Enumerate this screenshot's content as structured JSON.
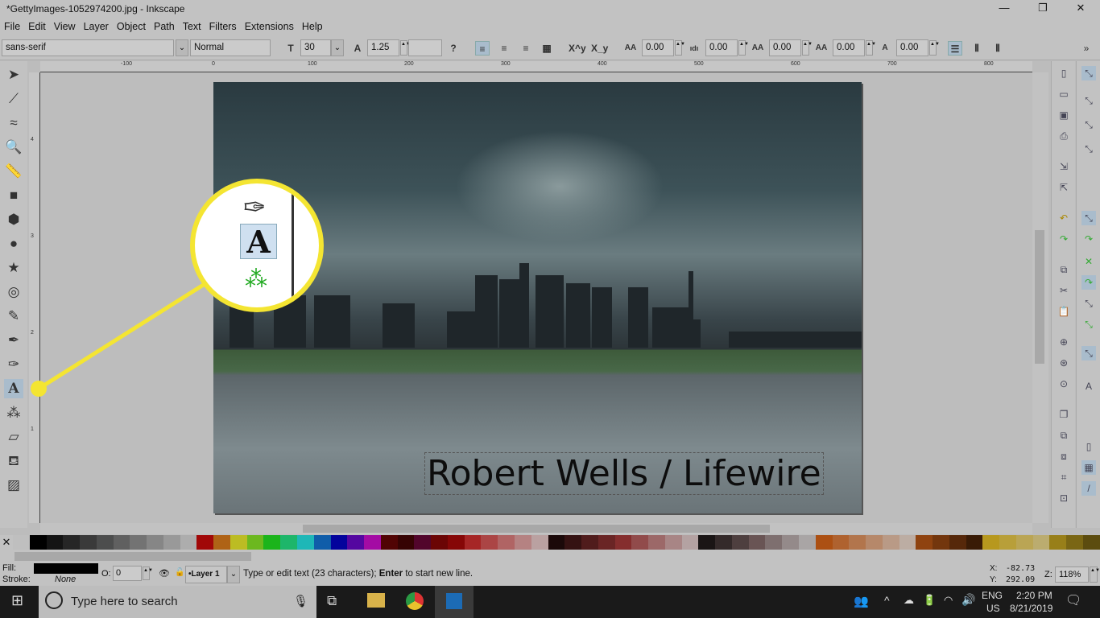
{
  "window": {
    "title": "*GettyImages-1052974200.jpg - Inkscape",
    "minimize": "—",
    "maximize": "❐",
    "close": "✕"
  },
  "menu": [
    "File",
    "Edit",
    "View",
    "Layer",
    "Object",
    "Path",
    "Text",
    "Filters",
    "Extensions",
    "Help"
  ],
  "text_toolbar": {
    "font_family": "sans-serif",
    "font_style": "Normal",
    "font_size": "30",
    "line_spacing": "1.25",
    "letter_spacing": "0.00",
    "word_spacing": "0.00",
    "kerning": "0.00",
    "vertical_shift": "0.00",
    "rotation": "0.00",
    "help": "?",
    "overflow": "»",
    "superscript": "X^y",
    "subscript": "X_y"
  },
  "ruler": {
    "h_ticks": [
      "-100",
      "0",
      "100",
      "200",
      "300",
      "400",
      "500",
      "600",
      "700",
      "800"
    ],
    "v_ticks": [
      "4",
      "3",
      "2",
      "1"
    ]
  },
  "tools": [
    "selector",
    "node",
    "tweak",
    "zoom",
    "measure",
    "rectangle",
    "3d-box",
    "ellipse",
    "star",
    "spiral",
    "pencil",
    "pen",
    "calligraphy",
    "text",
    "spray",
    "eraser",
    "paint-bucket",
    "gradient"
  ],
  "active_tool": "text",
  "canvas": {
    "text": "Robert Wells / Lifewire"
  },
  "palette": [
    "#ffffff",
    "#000000",
    "#1a1a1a",
    "#333333",
    "#4d4d4d",
    "#666666",
    "#808080",
    "#999999",
    "#b3b3b3",
    "#cccccc",
    "#e6e6e6",
    "#ff0000",
    "#ff8000",
    "#ffff00",
    "#80ff00",
    "#00ff00",
    "#00ff80",
    "#00ffff",
    "#0080ff",
    "#0000ff",
    "#8000ff",
    "#ff00ff",
    "#800000",
    "#550000",
    "#800040",
    "#aa0000",
    "#d40000",
    "#ff2a2a",
    "#ff5555",
    "#ff8080",
    "#ffaaaa",
    "#ffd5d5",
    "#280b0b",
    "#501616",
    "#782121",
    "#a02c2c",
    "#c83737",
    "#d35f5f",
    "#de8787",
    "#e9afaf",
    "#f4d7d7",
    "#241c1c",
    "#483737",
    "#6c5353",
    "#916f6f",
    "#ac9393",
    "#c8b7b7",
    "#e3dbdb",
    "#ff6600",
    "#ff7f2a",
    "#ff9955",
    "#ffb380",
    "#ffccaa",
    "#ffe6d5",
    "#d45500",
    "#aa4400",
    "#803300",
    "#552200",
    "#ffcc00",
    "#ffd42a",
    "#ffdd55",
    "#ffe680",
    "#d4aa00",
    "#aa8800",
    "#806600"
  ],
  "status": {
    "fill_label": "Fill:",
    "stroke_label": "Stroke:",
    "stroke_value": "None",
    "fill_color": "#000000",
    "opacity_label": "O:",
    "opacity": "0",
    "layer": "•Layer 1",
    "message_pre": "Type or edit text (23 characters); ",
    "message_bold": "Enter",
    "message_post": " to start new line.",
    "x_label": "X:",
    "x": "-82.73",
    "y_label": "Y:",
    "y": "292.09",
    "zoom_label": "Z:",
    "zoom": "118%"
  },
  "taskbar": {
    "search_placeholder": "Type here to search",
    "lang1": "ENG",
    "lang2": "US",
    "time": "2:20 PM",
    "date": "8/21/2019"
  },
  "colors": {
    "callout": "#f4e532",
    "active_tool_bg": "#a9bccc"
  }
}
